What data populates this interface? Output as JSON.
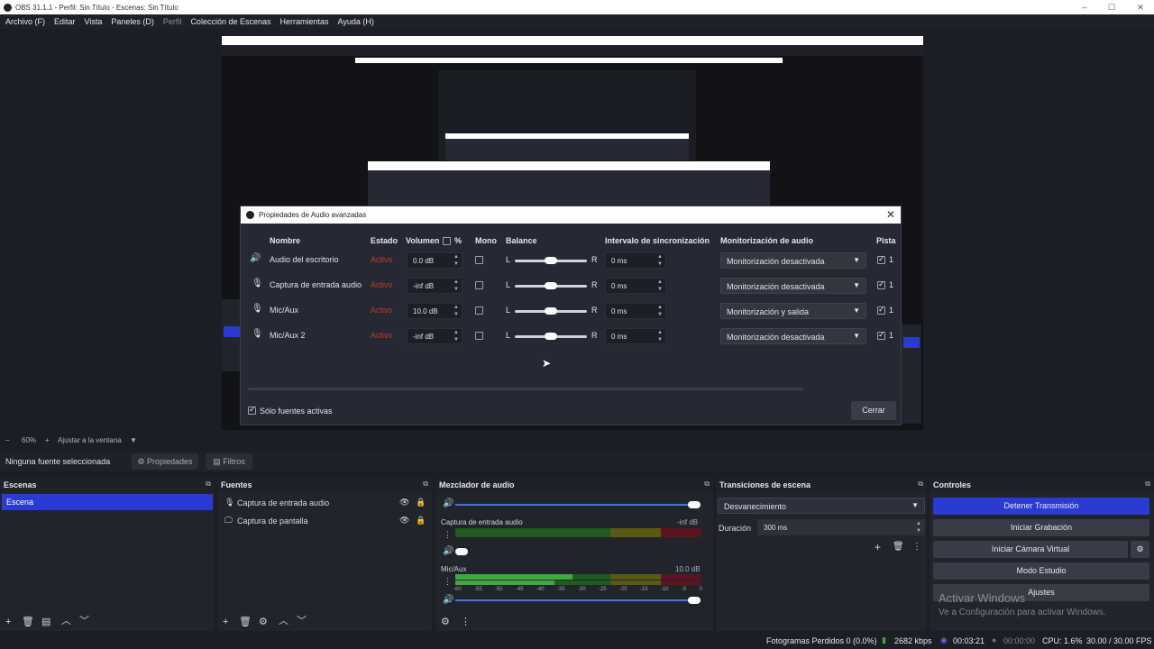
{
  "window": {
    "title": "OBS 31.1.1 - Perfil: Sin Título - Escenas: Sin Título"
  },
  "menu": [
    "Archivo (F)",
    "Editar",
    "Vista",
    "Paneles (D)",
    "Perfil",
    "Colección de Escenas",
    "Herramientas",
    "Ayuda (H)"
  ],
  "dialog": {
    "title": "Propiedades de Audio avanzadas",
    "headers": {
      "name": "Nombre",
      "state": "Estado",
      "volume": "Volumen",
      "percent": "%",
      "mono": "Mono",
      "balance": "Balance",
      "sync": "Intervalo de sincronización",
      "monitoring": "Monitorización de audio",
      "tracks": "Pista"
    },
    "rows": [
      {
        "icon": "speaker-icon",
        "name": "Audio del escritorio",
        "state": "Activo",
        "volume": "0.0 dB",
        "mono": false,
        "balance_l": "L",
        "balance_r": "R",
        "sync": "0 ms",
        "monitoring": "Monitorización desactivada",
        "track": "1"
      },
      {
        "icon": "microphone-icon",
        "name": "Captura de entrada audio",
        "state": "Activo",
        "volume": "-inf dB",
        "mono": false,
        "balance_l": "L",
        "balance_r": "R",
        "sync": "0 ms",
        "monitoring": "Monitorización desactivada",
        "track": "1"
      },
      {
        "icon": "microphone-icon",
        "name": "Mic/Aux",
        "state": "Activo",
        "volume": "10.0 dB",
        "mono": false,
        "balance_l": "L",
        "balance_r": "R",
        "sync": "0 ms",
        "monitoring": "Monitorización y salida",
        "track": "1"
      },
      {
        "icon": "microphone-icon",
        "name": "Mic/Aux 2",
        "state": "Activo",
        "volume": "-inf dB",
        "mono": false,
        "balance_l": "L",
        "balance_r": "R",
        "sync": "0 ms",
        "monitoring": "Monitorización desactivada",
        "track": "1"
      }
    ],
    "active_only": "Sólo fuentes activas",
    "close": "Cerrar"
  },
  "zoom": {
    "minus": "−",
    "value": "60%",
    "plus": "+",
    "fit": "Ajustar a la ventana"
  },
  "source_bar": {
    "none": "Ninguna fuente seleccionada",
    "properties": "Propiedades",
    "filters": "Filtros"
  },
  "scenes": {
    "title": "Escenas",
    "items": [
      "Escena"
    ]
  },
  "sources": {
    "title": "Fuentes",
    "items": [
      "Captura de entrada audio",
      "Captura de pantalla"
    ]
  },
  "mixer": {
    "title": "Mezclador de audio",
    "channels": [
      {
        "name": "Captura de entrada audio",
        "db": "-inf dB"
      },
      {
        "name": "Mic/Aux",
        "db": "10.0 dB"
      }
    ],
    "scale": [
      "-60",
      "-55",
      "-50",
      "-45",
      "-40",
      "-35",
      "-30",
      "-25",
      "-20",
      "-15",
      "-10",
      "-5",
      "0"
    ]
  },
  "transitions": {
    "title": "Transiciones de escena",
    "type": "Desvanecimiento",
    "duration_label": "Duración",
    "duration": "300 ms"
  },
  "controls": {
    "title": "Controles",
    "stop_stream": "Detener Transmisión",
    "start_record": "Iniciar Grabación",
    "virtual_cam": "Iniciar Cámara Virtual",
    "studio": "Modo Estudio",
    "settings": "Ajustes"
  },
  "watermark": {
    "line1": "Activar Windows",
    "line2": "Ve a Configuración para activar Windows."
  },
  "status": {
    "dropped": "Fotogramas Perdidos 0 (0.0%)",
    "bitrate": "2682 kbps",
    "live_time": "00:03:21",
    "rec_time": "00:00:00",
    "cpu": "CPU: 1.6%",
    "fps": "30.00 / 30.00 FPS"
  },
  "colors": {
    "accent": "#2a3bd4",
    "active": "#c0392b",
    "meter_green": "#3fa93f",
    "meter_yellow": "#8a8a1f",
    "meter_red": "#8b1c2c"
  }
}
